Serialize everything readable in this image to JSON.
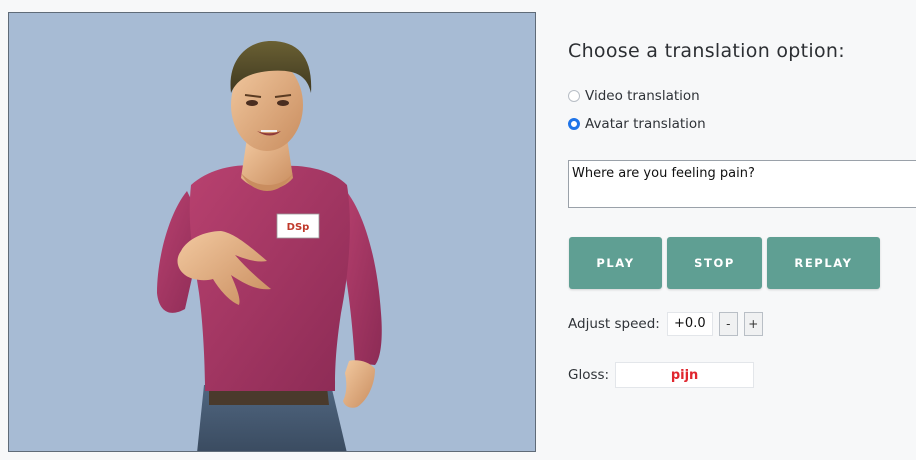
{
  "avatar": {
    "badge_text": "DSp",
    "background_color": "#a7bbd4",
    "shirt_color": "#a63866"
  },
  "options": {
    "title": "Choose a translation option:",
    "items": [
      {
        "label": "Video translation",
        "selected": false
      },
      {
        "label": "Avatar translation",
        "selected": true
      }
    ]
  },
  "sentence": {
    "value": "Where are you feeling pain?"
  },
  "buttons": {
    "play": "PLAY",
    "stop": "STOP",
    "replay": "REPLAY",
    "color": "#5f9f93"
  },
  "speed": {
    "label": "Adjust speed:",
    "value": "+0.0",
    "decrease": "-",
    "increase": "+"
  },
  "gloss": {
    "label": "Gloss:",
    "value": "pijn",
    "color": "#e0262e"
  }
}
